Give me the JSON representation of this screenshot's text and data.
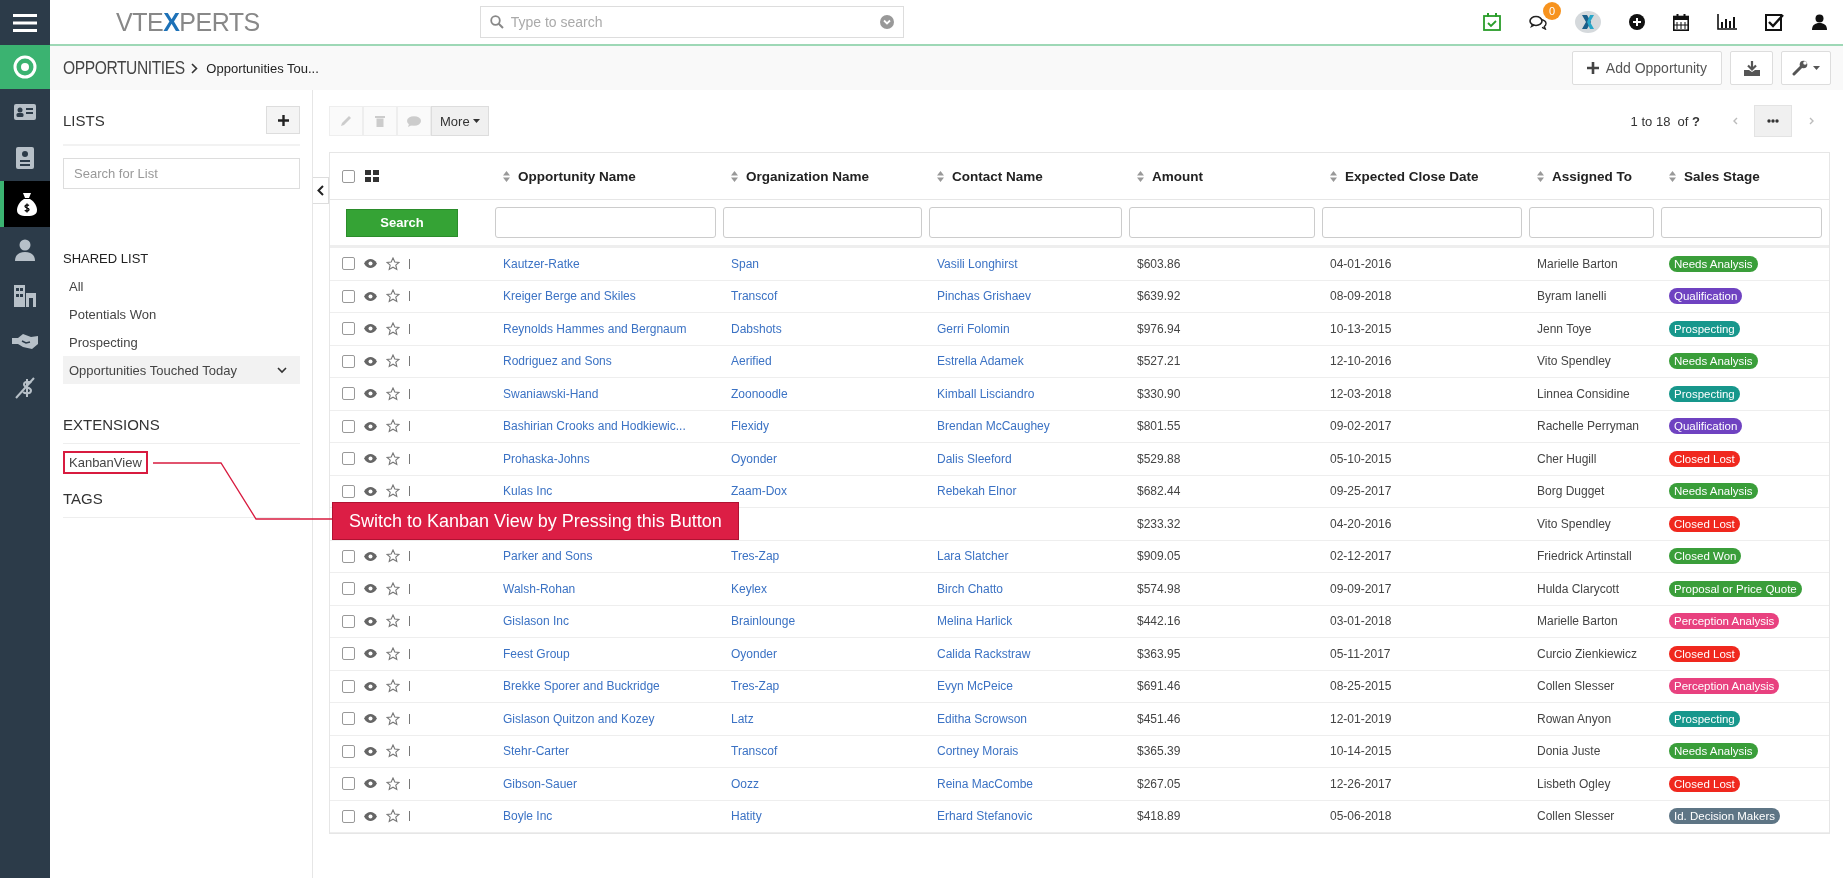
{
  "topbar": {
    "logo": {
      "before": "VTE",
      "mark": "X",
      "after": "PERTS"
    },
    "search": {
      "placeholder": "Type to search"
    },
    "icons": [
      {
        "kind": "calendar-check"
      },
      {
        "kind": "chat",
        "badge": "0"
      },
      {
        "kind": "x-logo"
      },
      {
        "kind": "plus-circle"
      },
      {
        "kind": "calendar"
      },
      {
        "kind": "bar-chart"
      },
      {
        "kind": "checkbox"
      },
      {
        "kind": "user"
      }
    ]
  },
  "nav": {
    "items": [
      {
        "kind": "target",
        "selected": false
      },
      {
        "kind": "contact-card",
        "selected": false
      },
      {
        "kind": "id-badge",
        "selected": false
      },
      {
        "kind": "money-bag",
        "selected": true
      },
      {
        "kind": "person",
        "selected": false
      },
      {
        "kind": "building",
        "selected": false
      },
      {
        "kind": "handshake",
        "selected": false
      },
      {
        "kind": "no-dollar",
        "selected": false
      }
    ]
  },
  "breadcrumb": {
    "module": "OPPORTUNITIES",
    "current": "Opportunities Tou..."
  },
  "actions": {
    "add_label": "Add Opportunity"
  },
  "lists_panel": {
    "title": "LISTS",
    "search": {
      "placeholder": "Search for List"
    },
    "shared_title": "SHARED LIST",
    "shared_items": [
      {
        "label": "All",
        "selected": false
      },
      {
        "label": "Potentials Won",
        "selected": false
      },
      {
        "label": "Prospecting",
        "selected": false
      },
      {
        "label": "Opportunities Touched Today",
        "selected": true
      }
    ],
    "extensions_title": "EXTENSIONS",
    "extensions": [
      "KanbanView"
    ],
    "tags_title": "TAGS"
  },
  "toolbar": {
    "more": "More",
    "pagination": "1 to 18  of **?**"
  },
  "table": {
    "columns": [
      "Opportunity Name",
      "Organization Name",
      "Contact Name",
      "Amount",
      "Expected Close Date",
      "Assigned To",
      "Sales Stage"
    ],
    "search_button": "Search",
    "select_all_checked": false,
    "rows": [
      {
        "name": "Kautzer-Ratke",
        "org": "Span",
        "contact": "Vasili Longhirst",
        "amount": "$603.86",
        "date": "04-01-2016",
        "assigned": "Marielle Barton",
        "stage": "Needs Analysis",
        "color": "#3a9e3a",
        "checked": false
      },
      {
        "name": "Kreiger Berge and Skiles",
        "org": "Transcof",
        "contact": "Pinchas Grishaev",
        "amount": "$639.92",
        "date": "08-09-2018",
        "assigned": "Byram Ianelli",
        "stage": "Qualification",
        "color": "#6f42c1",
        "checked": false
      },
      {
        "name": "Reynolds Hammes and Bergnaum",
        "org": "Dabshots",
        "contact": "Gerri Folomin",
        "amount": "$976.94",
        "date": "10-13-2015",
        "assigned": "Jenn Toye",
        "stage": "Prospecting",
        "color": "#17978c",
        "checked": false
      },
      {
        "name": "Rodriguez and Sons",
        "org": "Aerified",
        "contact": "Estrella Adamek",
        "amount": "$527.21",
        "date": "12-10-2016",
        "assigned": "Vito Spendley",
        "stage": "Needs Analysis",
        "color": "#3a9e3a",
        "checked": false
      },
      {
        "name": "Swaniawski-Hand",
        "org": "Zoonoodle",
        "contact": "Kimball Lisciandro",
        "amount": "$330.90",
        "date": "12-03-2018",
        "assigned": "Linnea Considine",
        "stage": "Prospecting",
        "color": "#17978c",
        "checked": false
      },
      {
        "name": "Bashirian Crooks and Hodkiewic...",
        "org": "Flexidy",
        "contact": "Brendan McCaughey",
        "amount": "$801.55",
        "date": "09-02-2017",
        "assigned": "Rachelle Perryman",
        "stage": "Qualification",
        "color": "#6f42c1",
        "checked": false
      },
      {
        "name": "Prohaska-Johns",
        "org": "Oyonder",
        "contact": "Dalis Sleeford",
        "amount": "$529.88",
        "date": "05-10-2015",
        "assigned": "Cher Hugill",
        "stage": "Closed Lost",
        "color": "#f0281e",
        "checked": false
      },
      {
        "name": "Kulas Inc",
        "org": "Zaam-Dox",
        "contact": "Rebekah Elnor",
        "amount": "$682.44",
        "date": "09-25-2017",
        "assigned": "Borg Dugget",
        "stage": "Needs Analysis",
        "color": "#3a9e3a",
        "checked": false
      },
      {
        "amount": "$233.32",
        "date": "04-20-2016",
        "assigned": "Vito Spendley",
        "stage": "Closed Lost",
        "color": "#f0281e"
      },
      {
        "name": "Parker and Sons",
        "org": "Tres-Zap",
        "contact": "Lara Slatcher",
        "amount": "$909.05",
        "date": "02-12-2017",
        "assigned": "Friedrick Artinstall",
        "stage": "Closed Won",
        "color": "#3a9e3a",
        "checked": false
      },
      {
        "name": "Walsh-Rohan",
        "org": "Keylex",
        "contact": "Birch Chatto",
        "amount": "$574.98",
        "date": "09-09-2017",
        "assigned": "Hulda Clarycott",
        "stage": "Proposal or Price Quote",
        "color": "#3a9e3a",
        "checked": false
      },
      {
        "name": "Gislason Inc",
        "org": "Brainlounge",
        "contact": "Melina Harlick",
        "amount": "$442.16",
        "date": "03-01-2018",
        "assigned": "Marielle Barton",
        "stage": "Perception Analysis",
        "color": "#e8417f",
        "checked": false
      },
      {
        "name": "Feest Group",
        "org": "Oyonder",
        "contact": "Calida Rackstraw",
        "amount": "$363.95",
        "date": "05-11-2017",
        "assigned": "Curcio Zienkiewicz",
        "stage": "Closed Lost",
        "color": "#f0281e",
        "checked": false
      },
      {
        "name": "Brekke Sporer and Buckridge",
        "org": "Tres-Zap",
        "contact": "Evyn McPeice",
        "amount": "$691.46",
        "date": "08-25-2015",
        "assigned": "Collen Slesser",
        "stage": "Perception Analysis",
        "color": "#e8417f",
        "checked": false
      },
      {
        "name": "Gislason Quitzon and Kozey",
        "org": "Latz",
        "contact": "Editha Scrowson",
        "amount": "$451.46",
        "date": "12-01-2019",
        "assigned": "Rowan Anyon",
        "stage": "Prospecting",
        "color": "#17978c",
        "checked": false
      },
      {
        "name": "Stehr-Carter",
        "org": "Transcof",
        "contact": "Cortney Morais",
        "amount": "$365.39",
        "date": "10-14-2015",
        "assigned": "Donia Juste",
        "stage": "Needs Analysis",
        "color": "#3a9e3a",
        "checked": false
      },
      {
        "name": "Gibson-Sauer",
        "org": "Oozz",
        "contact": "Reina MacCombe",
        "amount": "$267.05",
        "date": "12-26-2017",
        "assigned": "Lisbeth Ogley",
        "stage": "Closed Lost",
        "color": "#f0281e",
        "checked": false
      },
      {
        "name": "Boyle Inc",
        "org": "Hatity",
        "contact": "Erhard Stefanovic",
        "amount": "$418.89",
        "date": "05-06-2018",
        "assigned": "Collen Slesser",
        "stage": "Id. Decision Makers",
        "color": "#5e7585",
        "checked": false
      }
    ]
  },
  "callout": {
    "text": "Switch to Kanban View by Pressing this Button"
  }
}
